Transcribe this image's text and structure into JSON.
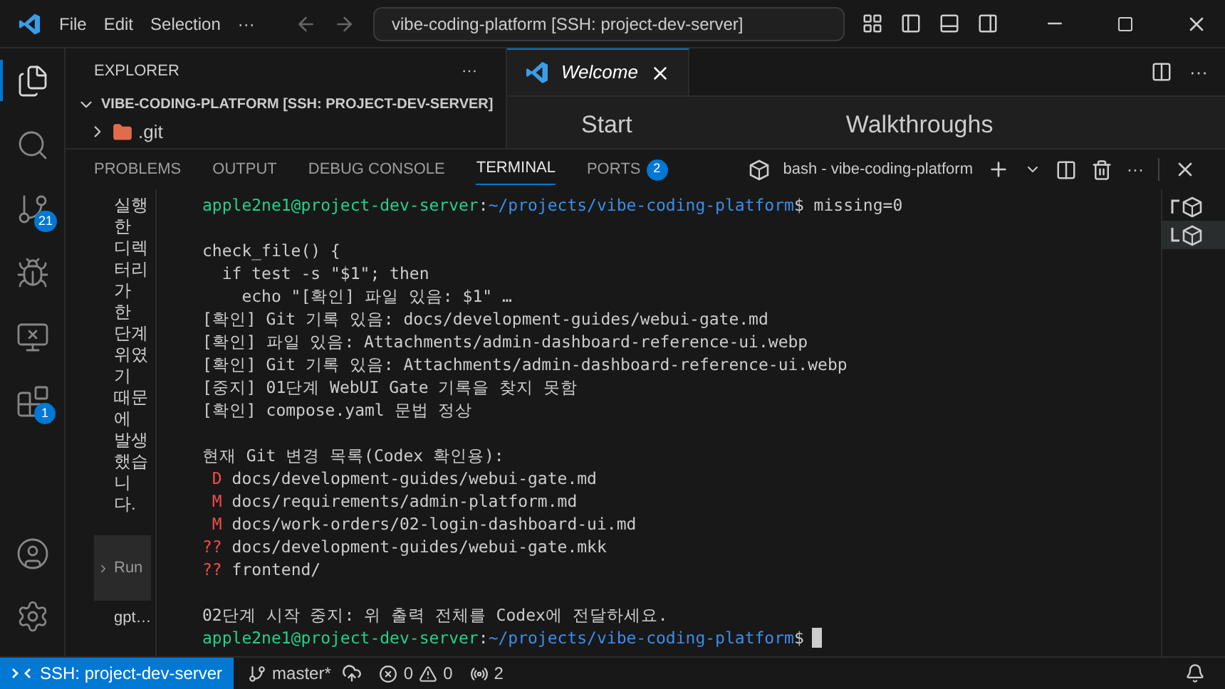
{
  "titlebar": {
    "menus": [
      "File",
      "Edit",
      "Selection",
      "···"
    ],
    "search": "vibe-coding-platform [SSH: project-dev-server]"
  },
  "activity_bar": [
    {
      "kind": "files",
      "selected": true
    },
    {
      "kind": "search",
      "selected": false
    },
    {
      "kind": "source-control",
      "selected": false,
      "badge": "21"
    },
    {
      "kind": "debug",
      "selected": false
    },
    {
      "kind": "remote",
      "selected": false
    },
    {
      "kind": "extensions",
      "selected": false,
      "badge": "1"
    }
  ],
  "explorer": {
    "title": "EXPLORER",
    "more": "···",
    "root": "VIBE-CODING-PLATFORM [SSH: PROJECT-DEV-SERVER]",
    "items": [
      {
        "name": ".git",
        "expanded": false
      }
    ]
  },
  "editor": {
    "tabs": [
      {
        "label": "Welcome",
        "selected": true
      }
    ],
    "more": "···",
    "headings": [
      "Start",
      "Walkthroughs"
    ]
  },
  "panel": {
    "tabs": [
      {
        "label": "PROBLEMS",
        "selected": false
      },
      {
        "label": "OUTPUT",
        "selected": false
      },
      {
        "label": "DEBUG CONSOLE",
        "selected": false
      },
      {
        "label": "TERMINAL",
        "selected": true
      },
      {
        "label": "PORTS",
        "selected": false,
        "badge": "2"
      }
    ],
    "terminal_name": "bash - vibe-coding-platform",
    "more": "···"
  },
  "chat": {
    "text": "실행한 디렉터리가 한 단계 위였기 때문에 발생했습니다.",
    "run_label": "Run",
    "footer": "gpt…"
  },
  "terminal": [
    {
      "kind": "prompt",
      "user": "apple2ne1@project-dev-server",
      "colon": ":",
      "path": "~/projects/vibe-coding-platform",
      "suffix": "$ missing=0",
      "cursor": false
    },
    {
      "kind": "blank"
    },
    {
      "kind": "text",
      "text": "check_file() {"
    },
    {
      "kind": "text",
      "text": "  if test -s \"$1\"; then"
    },
    {
      "kind": "text",
      "text": "    echo \"[확인] 파일 있음: $1\" …"
    },
    {
      "kind": "text",
      "text": "[확인] Git 기록 있음: docs/development-guides/webui-gate.md"
    },
    {
      "kind": "text",
      "text": "[확인] 파일 있음: Attachments/admin-dashboard-reference-ui.webp"
    },
    {
      "kind": "text",
      "text": "[확인] Git 기록 있음: Attachments/admin-dashboard-reference-ui.webp"
    },
    {
      "kind": "text",
      "text": "[중지] 01단계 WebUI Gate 기록을 찾지 못함"
    },
    {
      "kind": "text",
      "text": "[확인] compose.yaml 문법 정상"
    },
    {
      "kind": "blank"
    },
    {
      "kind": "text",
      "text": "현재 Git 변경 목록(Codex 확인용):"
    },
    {
      "kind": "git",
      "code": " D",
      "path": "docs/development-guides/webui-gate.md"
    },
    {
      "kind": "git",
      "code": " M",
      "path": "docs/requirements/admin-platform.md"
    },
    {
      "kind": "git",
      "code": " M",
      "path": "docs/work-orders/02-login-dashboard-ui.md"
    },
    {
      "kind": "git",
      "code": "??",
      "path": "docs/development-guides/webui-gate.mkk"
    },
    {
      "kind": "git",
      "code": "??",
      "path": "frontend/"
    },
    {
      "kind": "blank"
    },
    {
      "kind": "text",
      "text": "02단계 시작 중지: 위 출력 전체를 Codex에 전달하세요."
    },
    {
      "kind": "prompt",
      "user": "apple2ne1@project-dev-server",
      "colon": ":",
      "path": "~/projects/vibe-coding-platform",
      "suffix": "$",
      "cursor": true
    }
  ],
  "terminal_list": [
    {
      "selected": false
    },
    {
      "selected": true
    }
  ],
  "status_bar": {
    "remote": "SSH: project-dev-server",
    "branch": "master*",
    "errors": "0",
    "warnings": "0",
    "ports": "2"
  }
}
